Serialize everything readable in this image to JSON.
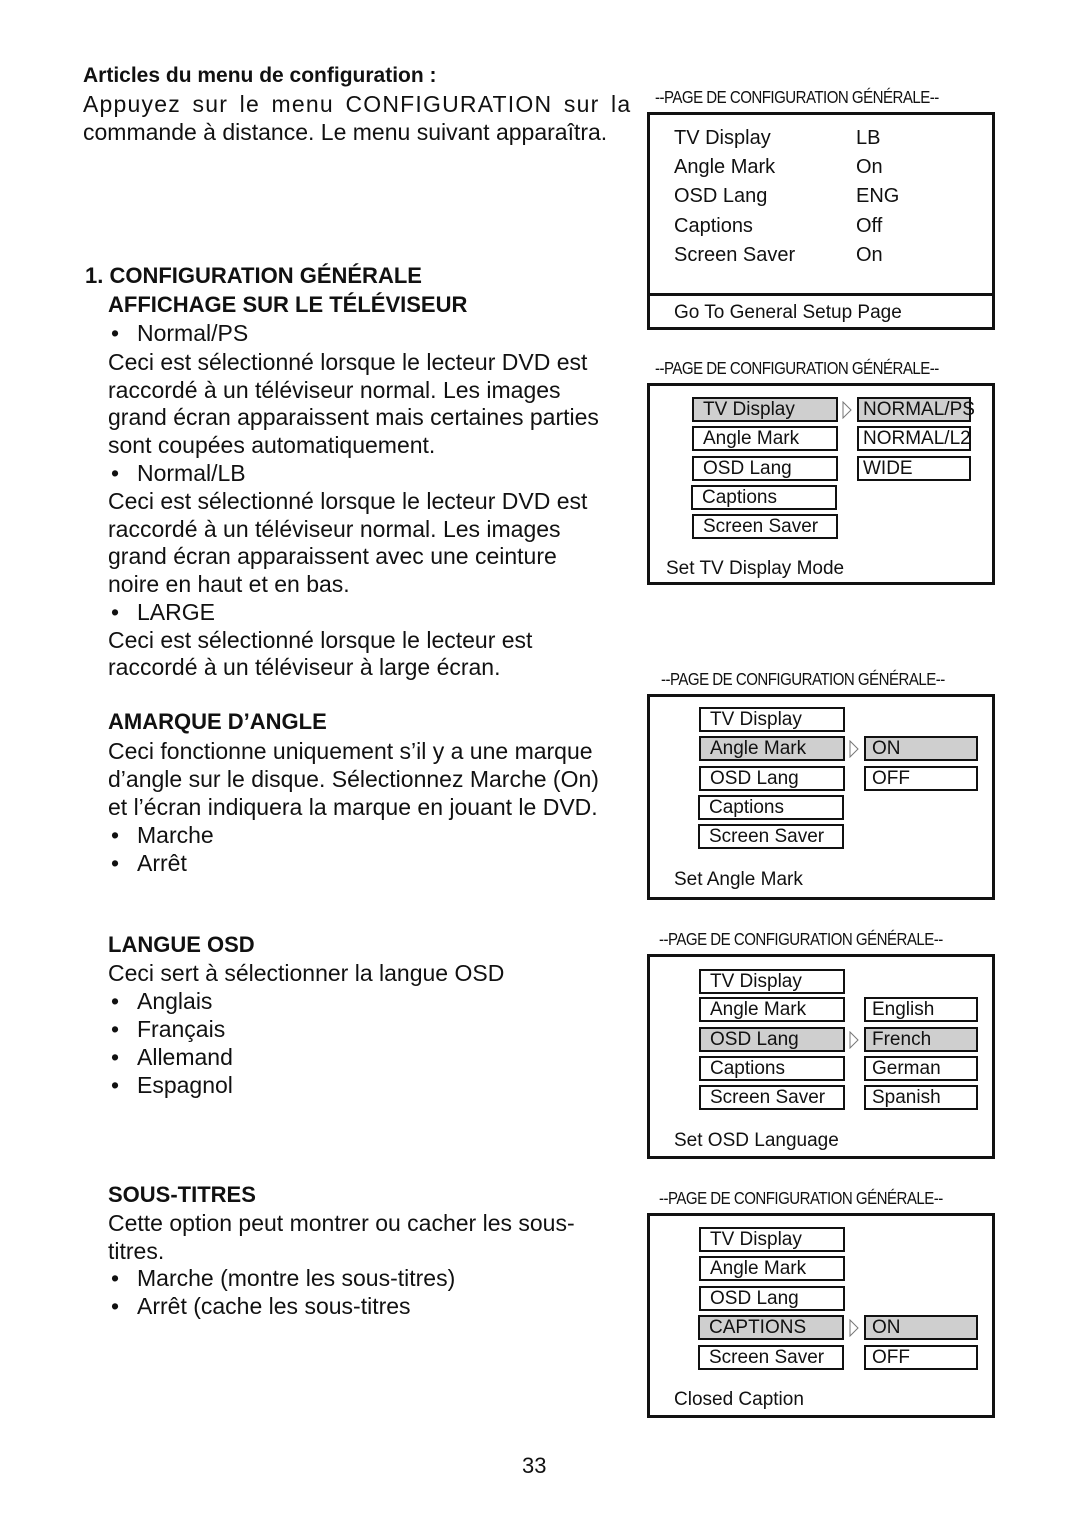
{
  "intro": {
    "heading": "Articles du menu de configuration :",
    "line1": "Appuyez sur le menu CONFIGURATION sur la",
    "line2": "commande à distance.  Le menu suivant apparaîtra."
  },
  "section_general": {
    "heading1": "1. CONFIGURATION GÉNÉRALE",
    "heading2": "AFFICHAGE SUR LE TÉLÉVISEUR",
    "bullet1": "Normal/PS",
    "desc1": [
      "Ceci est sélectionné lorsque le lecteur DVD est",
      "raccordé à un téléviseur normal.  Les images",
      "grand écran apparaissent mais certaines parties",
      "sont coupées automatiquement."
    ],
    "bullet2": "Normal/LB",
    "desc2": [
      "Ceci est sélectionné lorsque le lecteur DVD est",
      "raccordé à un téléviseur normal.  Les images",
      "grand écran apparaissent avec une ceinture",
      "noire en haut et en bas."
    ],
    "bullet3": "LARGE",
    "desc3": [
      "Ceci est sélectionné lorsque le lecteur est",
      "raccordé à un téléviseur à large écran."
    ]
  },
  "section_angle": {
    "heading": "AMARQUE D’ANGLE",
    "desc": [
      "Ceci fonctionne uniquement s’il y a une marque",
      "d’angle sur le disque.  Sélectionnez Marche (On)",
      "et l’écran indiquera la marque en jouant le DVD."
    ],
    "bullets": [
      "Marche",
      "Arrêt"
    ]
  },
  "section_osd": {
    "heading": "LANGUE OSD",
    "desc": "Ceci sert à sélectionner la langue OSD",
    "bullets": [
      "Anglais",
      "Français",
      "Allemand",
      "Espagnol"
    ]
  },
  "section_captions": {
    "heading": "SOUS-TITRES",
    "desc": [
      "Cette option peut montrer ou cacher les sous-",
      "titres."
    ],
    "bullets": [
      "Marche (montre les sous-titres)",
      "Arrêt (cache les sous-titres"
    ]
  },
  "bullet_glyph": "•",
  "menus": {
    "title": "--PAGE DE CONFIGURATION GÉNÉRALE--",
    "screen1": {
      "rows": [
        {
          "label": "TV Display",
          "value": "LB"
        },
        {
          "label": "Angle Mark",
          "value": "On"
        },
        {
          "label": "OSD Lang",
          "value": "ENG"
        },
        {
          "label": "Captions",
          "value": "Off"
        },
        {
          "label": "Screen Saver",
          "value": "On"
        }
      ],
      "footer": "Go To General Setup Page"
    },
    "screen2": {
      "items": [
        "TV Display",
        "Angle Mark",
        "OSD Lang",
        "Captions",
        "Screen Saver"
      ],
      "options": [
        "NORMAL/PS",
        "NORMAL/L2",
        "WIDE"
      ],
      "selected_item": "TV Display",
      "selected_option": "NORMAL/PS",
      "caption": "Set TV Display Mode"
    },
    "screen3": {
      "items": [
        "TV Display",
        "Angle Mark",
        "OSD Lang",
        "Captions",
        "Screen Saver"
      ],
      "options": [
        "ON",
        "OFF"
      ],
      "selected_item": "Angle Mark",
      "selected_option": "ON",
      "caption": "Set Angle Mark"
    },
    "screen4": {
      "items": [
        "TV Display",
        "Angle Mark",
        "OSD Lang",
        "Captions",
        "Screen Saver"
      ],
      "options": [
        "English",
        "French",
        "German",
        "Spanish"
      ],
      "selected_item": "OSD Lang",
      "selected_option": "French",
      "caption": "Set OSD Language"
    },
    "screen5": {
      "items": [
        "TV Display",
        "Angle Mark",
        "OSD Lang",
        "CAPTIONS",
        "Screen Saver"
      ],
      "options": [
        "ON",
        "OFF"
      ],
      "selected_item": "CAPTIONS",
      "selected_option": "ON",
      "caption": "Closed Caption"
    }
  },
  "page_number": "33"
}
